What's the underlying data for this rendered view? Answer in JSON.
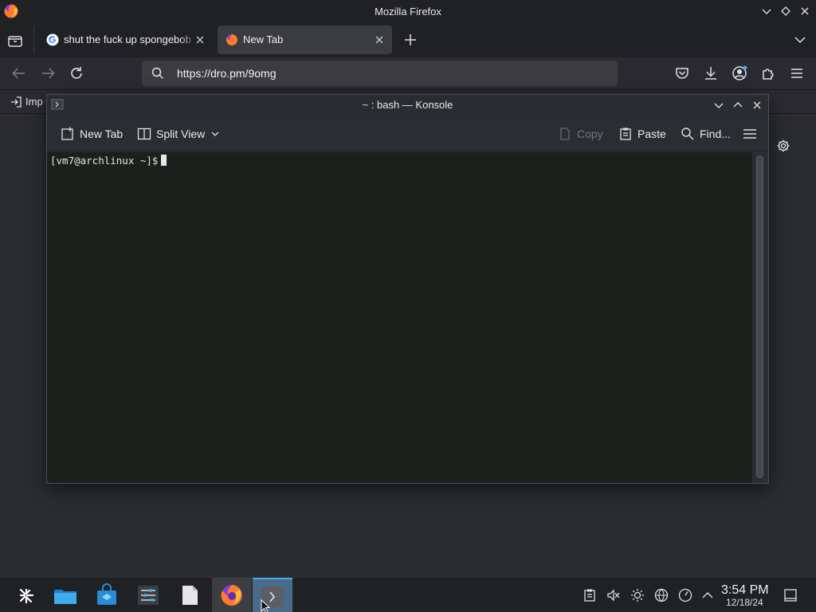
{
  "firefox": {
    "window_title": "Mozilla Firefox",
    "tabs": [
      {
        "label": "shut the fuck up spongebob",
        "favicon": "google-g-icon"
      },
      {
        "label": "New Tab",
        "favicon": "firefox-icon",
        "active": true
      }
    ],
    "url": "https://dro.pm/9omg",
    "bookmarks": [
      {
        "label": "Imp",
        "icon": "import-icon"
      }
    ]
  },
  "konsole": {
    "title": "~ : bash — Konsole",
    "toolbar": {
      "new_tab": "New Tab",
      "split_view": "Split View",
      "copy": "Copy",
      "paste": "Paste",
      "find": "Find..."
    },
    "terminal": {
      "prompt": "[vm7@archlinux ~]$"
    }
  },
  "taskbar": {
    "apps": [
      "app-launcher-icon",
      "file-manager-icon",
      "discover-store-icon",
      "system-settings-icon",
      "text-file-icon",
      "firefox-icon",
      "konsole-icon"
    ],
    "clock": {
      "time": "3:54 PM",
      "date": "12/18/24"
    }
  },
  "colors": {
    "accent": "#3daee9",
    "terminal_bg": "#1b201d",
    "chrome_bg": "#202124"
  }
}
